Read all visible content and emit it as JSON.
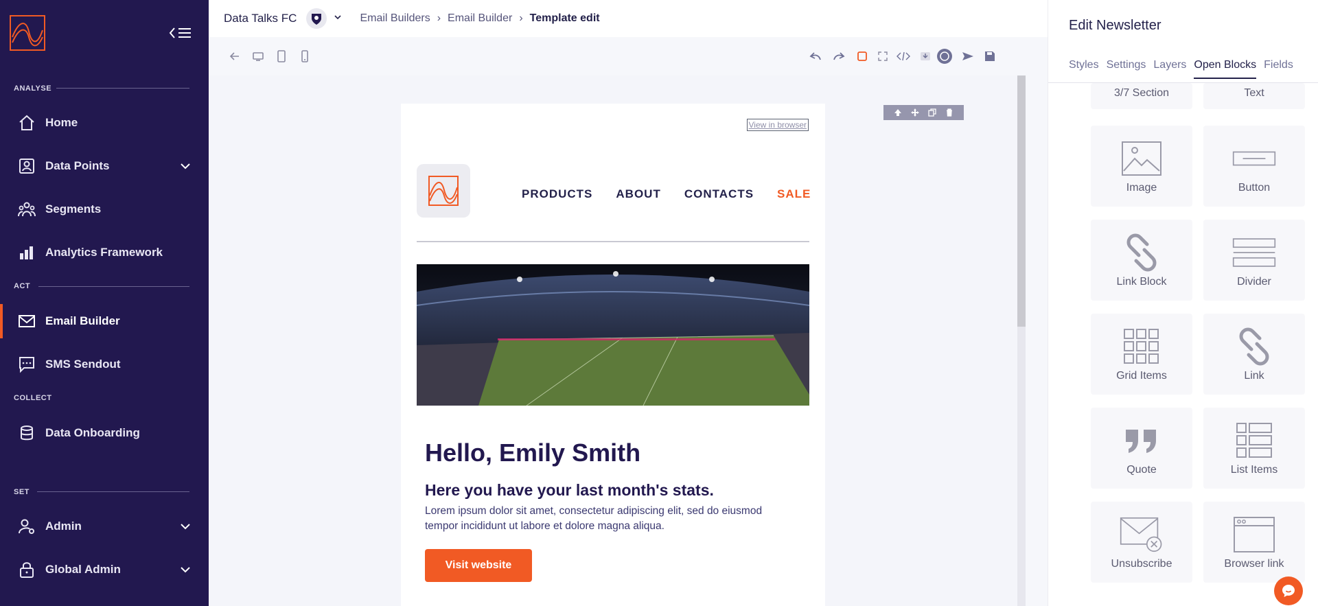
{
  "sidebar": {
    "sections": {
      "analyse": "ANALYSE",
      "act": "ACT",
      "collect": "COLLECT",
      "set": "SET"
    },
    "items": [
      {
        "label": "Home",
        "icon": "home-icon"
      },
      {
        "label": "Data Points",
        "icon": "user-card-icon"
      },
      {
        "label": "Segments",
        "icon": "people-icon"
      },
      {
        "label": "Analytics Framework",
        "icon": "bar-chart-icon"
      },
      {
        "label": "Email Builder",
        "icon": "mail-icon"
      },
      {
        "label": "SMS Sendout",
        "icon": "chat-dots-icon"
      },
      {
        "label": "Data Onboarding",
        "icon": "database-icon"
      },
      {
        "label": "Admin",
        "icon": "user-gear-icon"
      },
      {
        "label": "Global Admin",
        "icon": "lock-icon"
      }
    ]
  },
  "topbar": {
    "org_name": "Data Talks FC",
    "breadcrumbs": [
      "Email Builders",
      "Email Builder",
      "Template edit"
    ]
  },
  "email": {
    "view_in_browser": "View in browser",
    "menu": [
      "PRODUCTS",
      "ABOUT",
      "CONTACTS",
      "SALE"
    ],
    "heading": "Hello, Emily Smith",
    "subheading": "Here you have your last month's stats.",
    "body": "Lorem ipsum dolor sit amet, consectetur adipiscing elit, sed do eiusmod tempor incididunt ut labore et dolore magna aliqua.",
    "cta": "Visit website"
  },
  "panel": {
    "title": "Edit Newsletter",
    "tabs": [
      "Styles",
      "Settings",
      "Layers",
      "Open Blocks",
      "Fields"
    ],
    "blocks": [
      "3/7 Section",
      "Text",
      "Image",
      "Button",
      "Link Block",
      "Divider",
      "Grid Items",
      "Link",
      "Quote",
      "List Items",
      "Unsubscribe",
      "Browser link"
    ]
  },
  "colors": {
    "sidebar_bg": "#22184f",
    "accent": "#f15a24",
    "text_dark": "#23214a"
  }
}
